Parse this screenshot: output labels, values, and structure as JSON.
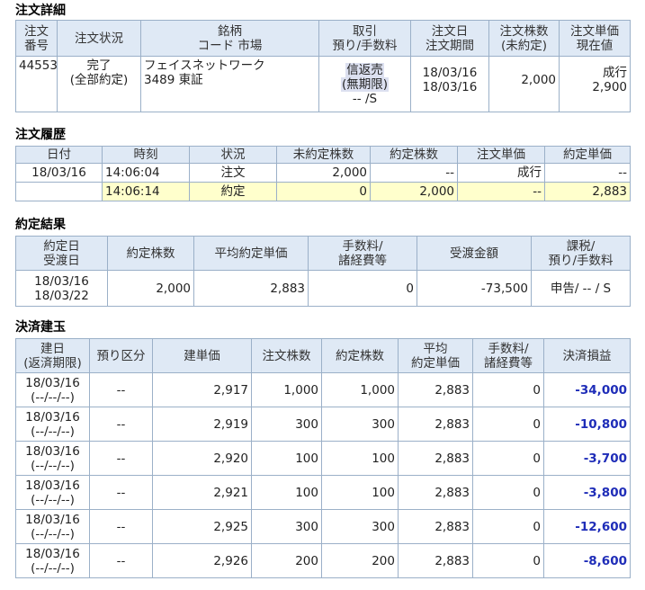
{
  "order_detail": {
    "title": "注文詳細",
    "headers": [
      "注文",
      "番号",
      "注文状況",
      "銘柄",
      "コード 市場",
      "取引",
      "預り/手数料",
      "注文日",
      "注文期間",
      "注文株数",
      "(未約定)",
      "注文単価",
      "現在値"
    ],
    "row": {
      "order_no": "44553",
      "status1": "完了",
      "status2": "(全部約定)",
      "name": "フェイスネットワーク",
      "code_market": "3489 東証",
      "trade1": "信返売",
      "trade2": "(無期限)",
      "trade3": "-- /S",
      "date1": "18/03/16",
      "date2": "18/03/16",
      "shares": "2,000",
      "price1": "成行",
      "price2": "2,900"
    }
  },
  "order_history": {
    "title": "注文履歴",
    "headers": [
      "日付",
      "時刻",
      "状況",
      "未約定株数",
      "約定株数",
      "注文単価",
      "約定単価"
    ],
    "rows": [
      {
        "date": "18/03/16",
        "time": "14:06:04",
        "status": "注文",
        "unexec": "2,000",
        "exec": "--",
        "order_price": "成行",
        "exec_price": "--"
      },
      {
        "date": "",
        "time": "14:06:14",
        "status": "約定",
        "unexec": "0",
        "exec": "2,000",
        "order_price": "--",
        "exec_price": "2,883"
      }
    ]
  },
  "exec_result": {
    "title": "約定結果",
    "headers": [
      "約定日",
      "受渡日",
      "約定株数",
      "平均約定単価",
      "手数料/",
      "諸経費等",
      "受渡金額",
      "課税/",
      "預り/手数料"
    ],
    "row": {
      "date1": "18/03/16",
      "date2": "18/03/22",
      "shares": "2,000",
      "avg_price": "2,883",
      "fee": "0",
      "amount": "-73,500",
      "tax": "申告/ -- / S"
    }
  },
  "settlement": {
    "title": "決済建玉",
    "headers": [
      "建日",
      "(返済期限)",
      "預り区分",
      "建単価",
      "注文株数",
      "約定株数",
      "平均",
      "約定単価",
      "手数料/",
      "諸経費等",
      "決済損益"
    ],
    "rows": [
      {
        "date": "18/03/16",
        "due": "(--/--/--)",
        "kind": "--",
        "price": "2,917",
        "order_shares": "1,000",
        "exec_shares": "1,000",
        "avg": "2,883",
        "fee": "0",
        "pl": "-34,000"
      },
      {
        "date": "18/03/16",
        "due": "(--/--/--)",
        "kind": "--",
        "price": "2,919",
        "order_shares": "300",
        "exec_shares": "300",
        "avg": "2,883",
        "fee": "0",
        "pl": "-10,800"
      },
      {
        "date": "18/03/16",
        "due": "(--/--/--)",
        "kind": "--",
        "price": "2,920",
        "order_shares": "100",
        "exec_shares": "100",
        "avg": "2,883",
        "fee": "0",
        "pl": "-3,700"
      },
      {
        "date": "18/03/16",
        "due": "(--/--/--)",
        "kind": "--",
        "price": "2,921",
        "order_shares": "100",
        "exec_shares": "100",
        "avg": "2,883",
        "fee": "0",
        "pl": "-3,800"
      },
      {
        "date": "18/03/16",
        "due": "(--/--/--)",
        "kind": "--",
        "price": "2,925",
        "order_shares": "300",
        "exec_shares": "300",
        "avg": "2,883",
        "fee": "0",
        "pl": "-12,600"
      },
      {
        "date": "18/03/16",
        "due": "(--/--/--)",
        "kind": "--",
        "price": "2,926",
        "order_shares": "200",
        "exec_shares": "200",
        "avg": "2,883",
        "fee": "0",
        "pl": "-8,600"
      }
    ]
  },
  "colors": {
    "header_bg": "#dfe9f5",
    "border": "#9bb0c8",
    "highlight_row": "#ffffcc",
    "negative": "#1f2db8"
  }
}
